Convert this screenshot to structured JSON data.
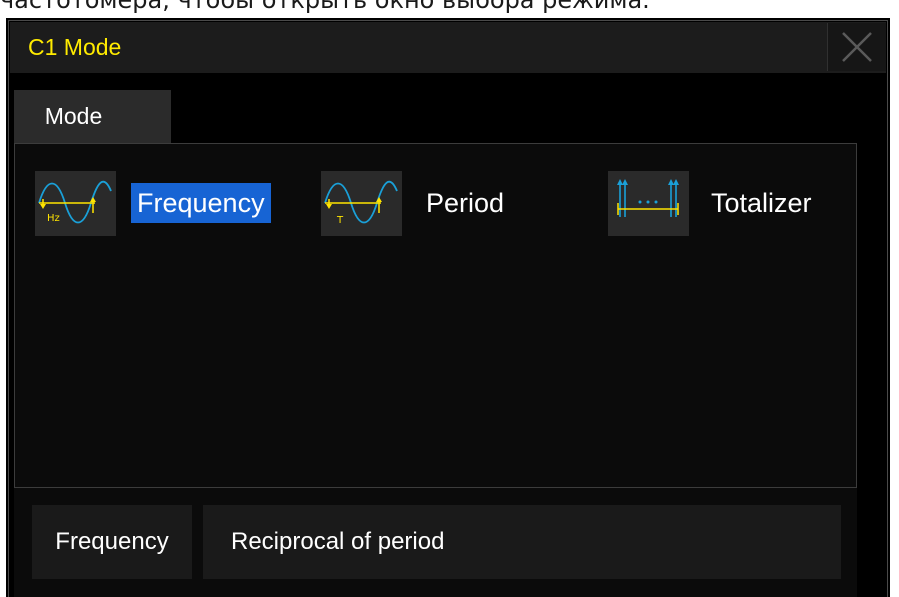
{
  "document": {
    "caption": "частотомера, чтобы открыть окно выбора режима."
  },
  "dialog": {
    "title": "C1 Mode",
    "close_icon": "close-icon",
    "tabs": [
      {
        "label": "Mode",
        "active": true
      }
    ],
    "modes": [
      {
        "label": "Frequency",
        "icon": "frequency-waveform-icon",
        "icon_text": "Hz",
        "selected": true
      },
      {
        "label": "Period",
        "icon": "period-waveform-icon",
        "icon_text": "T",
        "selected": false
      },
      {
        "label": "Totalizer",
        "icon": "totalizer-counter-icon",
        "selected": false
      }
    ],
    "info": {
      "name": "Frequency",
      "description": "Reciprocal of period"
    }
  },
  "colors": {
    "title": "#ffeb00",
    "selection": "#1764d4",
    "waveform": "#1aa0d8",
    "marker": "#ffe400",
    "background": "#000000"
  }
}
